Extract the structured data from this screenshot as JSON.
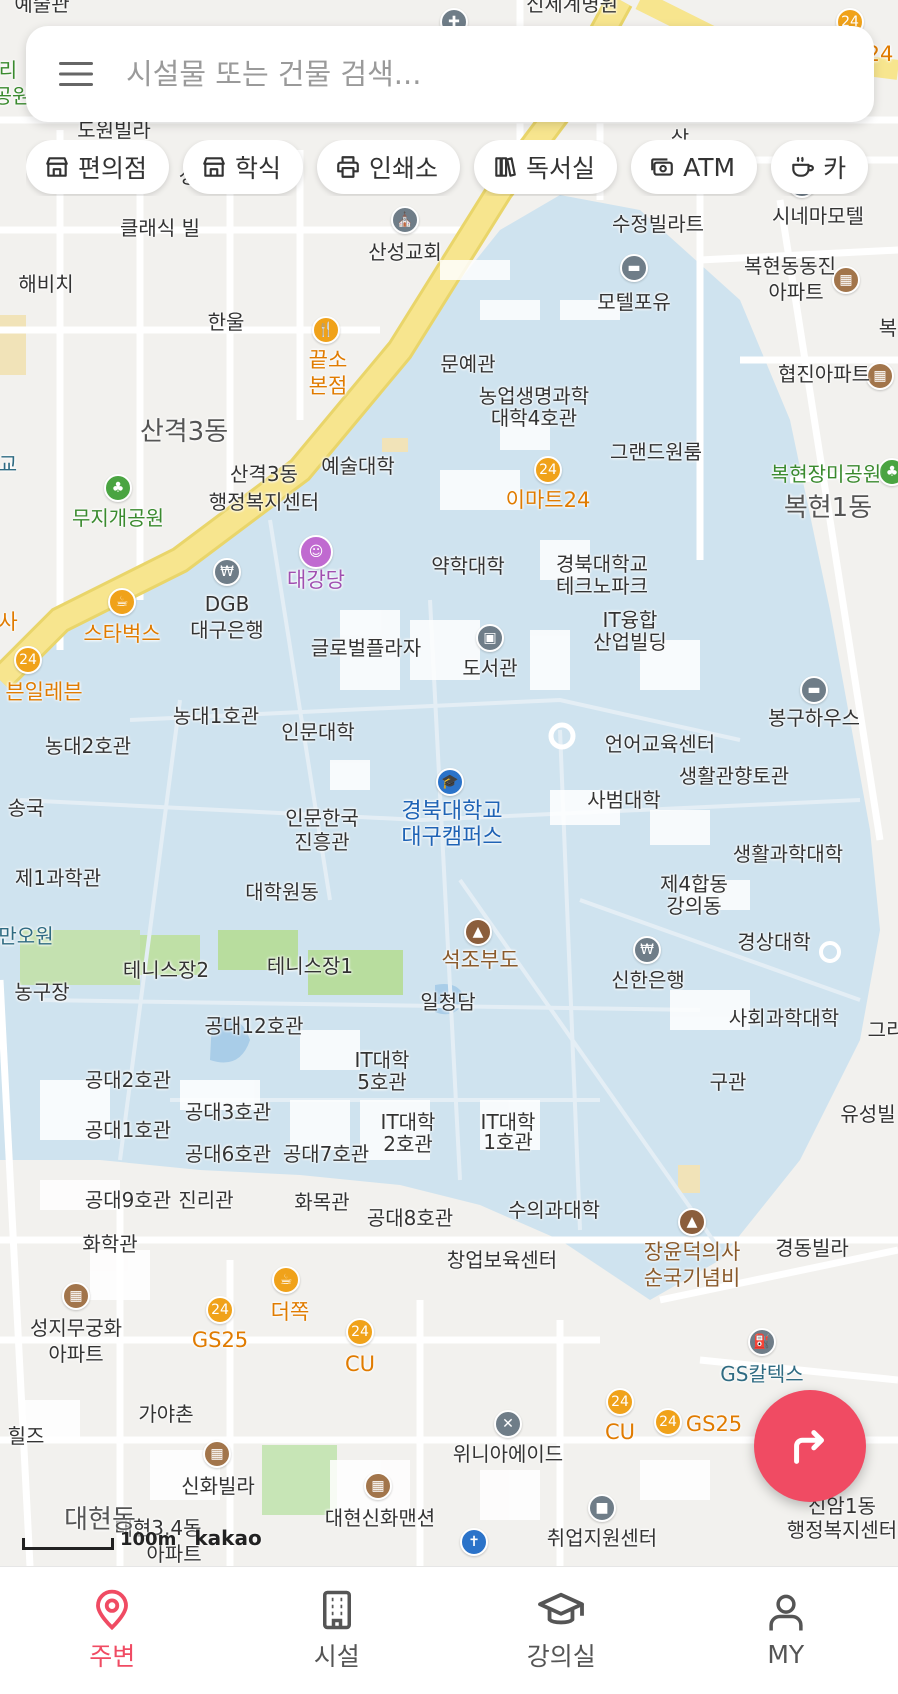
{
  "search": {
    "placeholder": "시설물 또는 건물 검색..."
  },
  "chips": [
    {
      "label": "편의점",
      "icon": "store-icon"
    },
    {
      "label": "학식",
      "icon": "store-icon"
    },
    {
      "label": "인쇄소",
      "icon": "printer-icon"
    },
    {
      "label": "독서실",
      "icon": "books-icon"
    },
    {
      "label": "ATM",
      "icon": "money-icon"
    },
    {
      "label": "카",
      "icon": "cafe-icon"
    }
  ],
  "map": {
    "labels": {
      "l1": "예술관",
      "l2": "신세계병원",
      "l3": "도원빌라",
      "l4": "클래식 빌",
      "l5": "해비치",
      "l6": "한울",
      "l7": "산성교회",
      "l8": "수정빌라트",
      "l9": "시네마모텔",
      "l10": "복현동동진",
      "l11": "아파트",
      "l12": "모텔포유",
      "l13": "끝소",
      "l14": "본점",
      "l15": "문예관",
      "l16": "농업생명과학",
      "l17": "대학4호관",
      "l18": "협진아파트",
      "l19": "산격3동",
      "l20": "산격3동",
      "l21": "행정복지센터",
      "l22": "예술대학",
      "l23": "그랜드원룸",
      "l24": "이마트24",
      "l25": "복현장미공원",
      "l26": "복현1동",
      "l27": "무지개공원",
      "l28": "대강당",
      "l29": "약학대학",
      "l30": "경북대학교",
      "l31": "테크노파크",
      "l32": "DGB",
      "l33": "대구은행",
      "l34": "스타벅스",
      "l35": "IT융합",
      "l36": "산업빌딩",
      "l37": "글로벌플라자",
      "l38": "도서관",
      "l39": "봉구하우스",
      "l40": "븐일레븐",
      "l41": "농대1호관",
      "l42": "농대2호관",
      "l43": "인문대학",
      "l44": "언어교육센터",
      "l45": "생활관향토관",
      "l46": "송국",
      "l47": "사범대학",
      "l48": "인문한국",
      "l49": "진흥관",
      "l50": "경북대학교",
      "l51": "대구캠퍼스",
      "l52": "생활과학대학",
      "l53": "제1과학관",
      "l54": "제4합동",
      "l55": "강의동",
      "l56": "대학원동",
      "l57": "경상대학",
      "l58": "만오원",
      "l59": "석조부도",
      "l60": "신한은행",
      "l61": "테니스장2",
      "l62": "테니스장1",
      "l63": "농구장",
      "l64": "일청담",
      "l65": "사회과학대학",
      "l66": "공대12호관",
      "l67": "IT대학",
      "l68": "5호관",
      "l69": "공대2호관",
      "l70": "구관",
      "l71": "유성빌",
      "l72": "공대3호관",
      "l73": "IT대학",
      "l74": "2호관",
      "l75": "IT대학",
      "l76": "1호관",
      "l77": "공대1호관",
      "l78": "공대6호관",
      "l79": "공대7호관",
      "l80": "공대9호관",
      "l81": "진리관",
      "l82": "화목관",
      "l83": "공대8호관",
      "l84": "수의과대학",
      "l85": "화학관",
      "l86": "창업보육센터",
      "l87": "장윤덕의사",
      "l88": "순국기념비",
      "l89": "경동빌라",
      "l90": "성지무궁화",
      "l91": "아파트",
      "l92": "더쪽",
      "l93": "GS25",
      "l94": "CU",
      "l95": "GS칼텍스",
      "l96": "가야촌",
      "l97": "힐즈",
      "l98": "위니아에이드",
      "l99": "CU",
      "l100": "GS25",
      "l101": "신화빌라",
      "l102": "대현신화맨션",
      "l103": "신암1동",
      "l104": "행정복지센터",
      "l105": "대현3.4동",
      "l106": "아파트",
      "l107": "취업지원센터",
      "l108": "대현동",
      "l109": "교",
      "l110": "사",
      "l111": "공원",
      "l112": "리",
      "l113": "성",
      "l114": "그리",
      "l115": "복",
      "l116": "24",
      "l117": "상"
    },
    "scale": "100m",
    "attribution": "kakao"
  },
  "nav": [
    {
      "label": "주변",
      "active": true
    },
    {
      "label": "시설",
      "active": false
    },
    {
      "label": "강의실",
      "active": false
    },
    {
      "label": "MY",
      "active": false
    }
  ],
  "colors": {
    "accent": "#f04b63",
    "campus": "#cfe3ef",
    "major_road": "#f7e58e",
    "park": "#b9dfa7"
  }
}
